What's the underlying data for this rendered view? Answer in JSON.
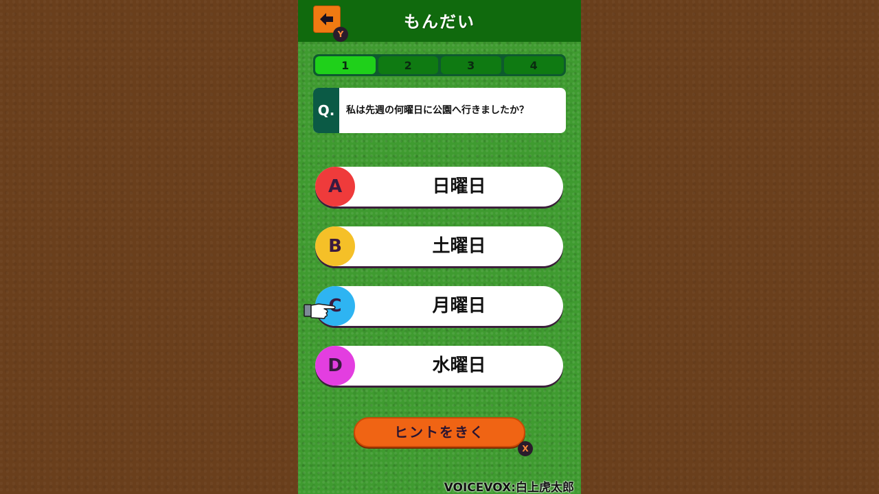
{
  "header": {
    "title": "もんだい",
    "back_icon": "arrow-left-icon",
    "back_key": "Y"
  },
  "question_tabs": [
    "1",
    "2",
    "3",
    "4"
  ],
  "active_tab": 0,
  "question": {
    "mark": "Q.",
    "text": "私は先週の何曜日に公園へ行きましたか？"
  },
  "answers": [
    {
      "letter": "A",
      "text": "日曜日",
      "color": "#ef3b3b"
    },
    {
      "letter": "B",
      "text": "土曜日",
      "color": "#f5c028"
    },
    {
      "letter": "C",
      "text": "月曜日",
      "color": "#2eb4f2"
    },
    {
      "letter": "D",
      "text": "水曜日",
      "color": "#e33ee0"
    }
  ],
  "hint": {
    "label": "ヒントをきく",
    "key": "X"
  },
  "credit": "VOICEVOX:白上虎太郎",
  "colors": {
    "header": "#106a0d",
    "field": "#3f9b30",
    "side_background": "#6a3f1c",
    "accent_orange": "#f06414",
    "tab_active": "#1fd01a"
  }
}
